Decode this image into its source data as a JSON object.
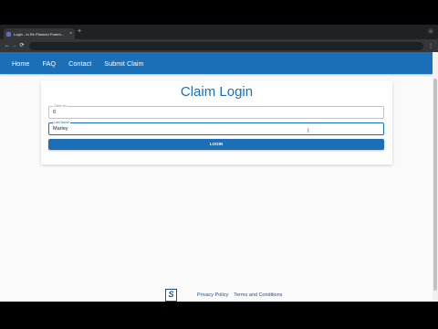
{
  "browser": {
    "tab_title": "Login - In Re Planned Parent...",
    "tab_close": "×",
    "new_tab": "+",
    "back": "←",
    "forward": "→",
    "reload": "⟳",
    "menu": "⋮",
    "tab_menu": "⌄"
  },
  "navbar": {
    "items": [
      {
        "label": "Home"
      },
      {
        "label": "FAQ"
      },
      {
        "label": "Contact"
      },
      {
        "label": "Submit Claim"
      }
    ]
  },
  "login": {
    "title": "Claim Login",
    "claim_no": {
      "label": "Claim No",
      "value": "0"
    },
    "last_name": {
      "label": "Last Name",
      "value": "Marley"
    },
    "button_label": "LOGIN"
  },
  "cursor": "I",
  "footer": {
    "logo_letter": "S",
    "privacy_label": "Privacy Policy",
    "terms_label": "Terms and Conditions"
  },
  "colors": {
    "brand_blue": "#1a6fb7",
    "footer_blue": "#1a4f99",
    "page_bg": "#fafafa"
  }
}
